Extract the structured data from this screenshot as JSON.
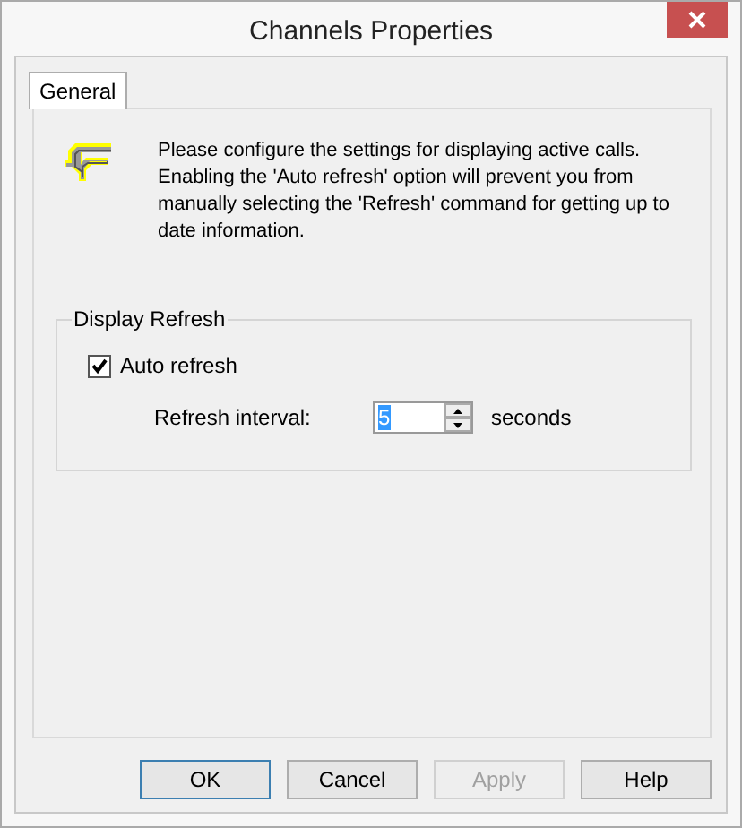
{
  "window": {
    "title": "Channels Properties"
  },
  "tabs": [
    {
      "label": "General",
      "selected": true
    }
  ],
  "description": "Please configure the settings for displaying active calls. Enabling the 'Auto refresh' option will prevent you from manually selecting the 'Refresh' command for getting up to date information.",
  "group": {
    "title": "Display Refresh",
    "auto_refresh": {
      "label": "Auto refresh",
      "checked": true
    },
    "interval": {
      "label": "Refresh interval:",
      "value": "5",
      "unit": "seconds"
    }
  },
  "buttons": [
    {
      "label": "OK",
      "default": true,
      "disabled": false
    },
    {
      "label": "Cancel",
      "default": false,
      "disabled": false
    },
    {
      "label": "Apply",
      "default": false,
      "disabled": true
    },
    {
      "label": "Help",
      "default": false,
      "disabled": false
    }
  ]
}
